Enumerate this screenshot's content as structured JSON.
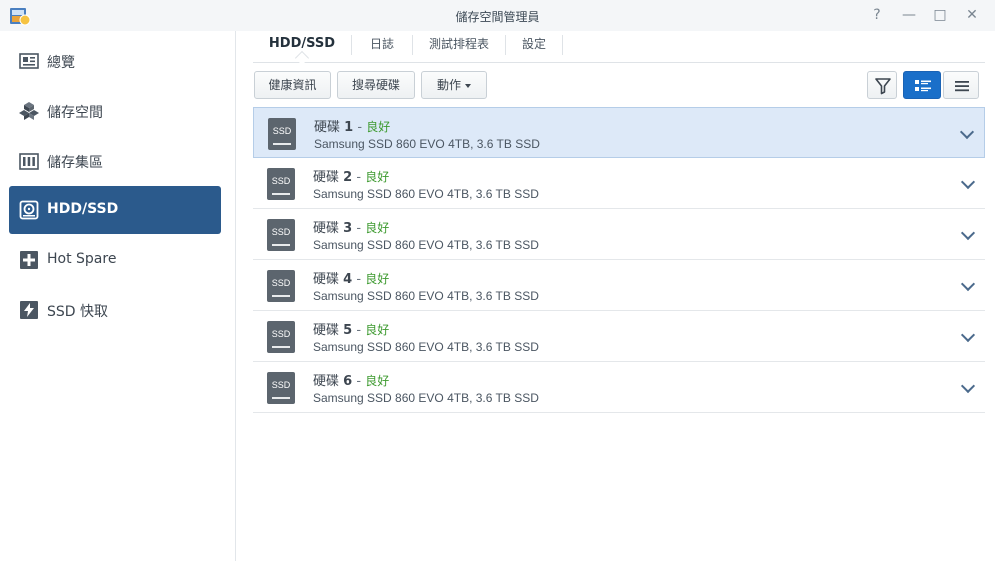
{
  "window": {
    "title": "儲存空間管理員",
    "controls": {
      "help": "?",
      "minimize": "—",
      "maximize": "□",
      "close": "✕"
    }
  },
  "sidebar": {
    "items": [
      {
        "label": "總覽",
        "icon": "overview-icon",
        "active": false
      },
      {
        "label": "儲存空間",
        "icon": "storage-pool-cubes-icon",
        "active": false
      },
      {
        "label": "儲存集區",
        "icon": "storage-volume-bars-icon",
        "active": false
      },
      {
        "label": "HDD/SSD",
        "icon": "disk-icon",
        "active": true
      },
      {
        "label": "Hot Spare",
        "icon": "plus-box-icon",
        "active": false
      },
      {
        "label": "SSD 快取",
        "icon": "lightning-icon",
        "active": false
      }
    ]
  },
  "tabs": [
    {
      "label": "HDD/SSD",
      "active": true
    },
    {
      "label": "日誌",
      "active": false
    },
    {
      "label": "測試排程表",
      "active": false
    },
    {
      "label": "設定",
      "active": false
    }
  ],
  "toolbar": {
    "health_info": "健康資訊",
    "search_disk": "搜尋硬碟",
    "action": "動作",
    "filter_icon": "filter-icon",
    "view_list_icon": "detail-list-view-icon",
    "view_compact_icon": "compact-list-view-icon"
  },
  "disks": [
    {
      "icon_text": "SSD",
      "name": "硬碟",
      "number": "1",
      "dash": "-",
      "status": "良好",
      "desc": "Samsung SSD 860 EVO 4TB, 3.6 TB SSD",
      "selected": true
    },
    {
      "icon_text": "SSD",
      "name": "硬碟",
      "number": "2",
      "dash": "-",
      "status": "良好",
      "desc": "Samsung SSD 860 EVO 4TB, 3.6 TB SSD",
      "selected": false
    },
    {
      "icon_text": "SSD",
      "name": "硬碟",
      "number": "3",
      "dash": "-",
      "status": "良好",
      "desc": "Samsung SSD 860 EVO 4TB, 3.6 TB SSD",
      "selected": false
    },
    {
      "icon_text": "SSD",
      "name": "硬碟",
      "number": "4",
      "dash": "-",
      "status": "良好",
      "desc": "Samsung SSD 860 EVO 4TB, 3.6 TB SSD",
      "selected": false
    },
    {
      "icon_text": "SSD",
      "name": "硬碟",
      "number": "5",
      "dash": "-",
      "status": "良好",
      "desc": "Samsung SSD 860 EVO 4TB, 3.6 TB SSD",
      "selected": false
    },
    {
      "icon_text": "SSD",
      "name": "硬碟",
      "number": "6",
      "dash": "-",
      "status": "良好",
      "desc": "Samsung SSD 860 EVO 4TB, 3.6 TB SSD",
      "selected": false
    }
  ],
  "colors": {
    "sidebar_active": "#2b5a8c",
    "status_good": "#3d9a2f",
    "selected_row": "#dde9f8",
    "view_active": "#1a6fc9"
  }
}
